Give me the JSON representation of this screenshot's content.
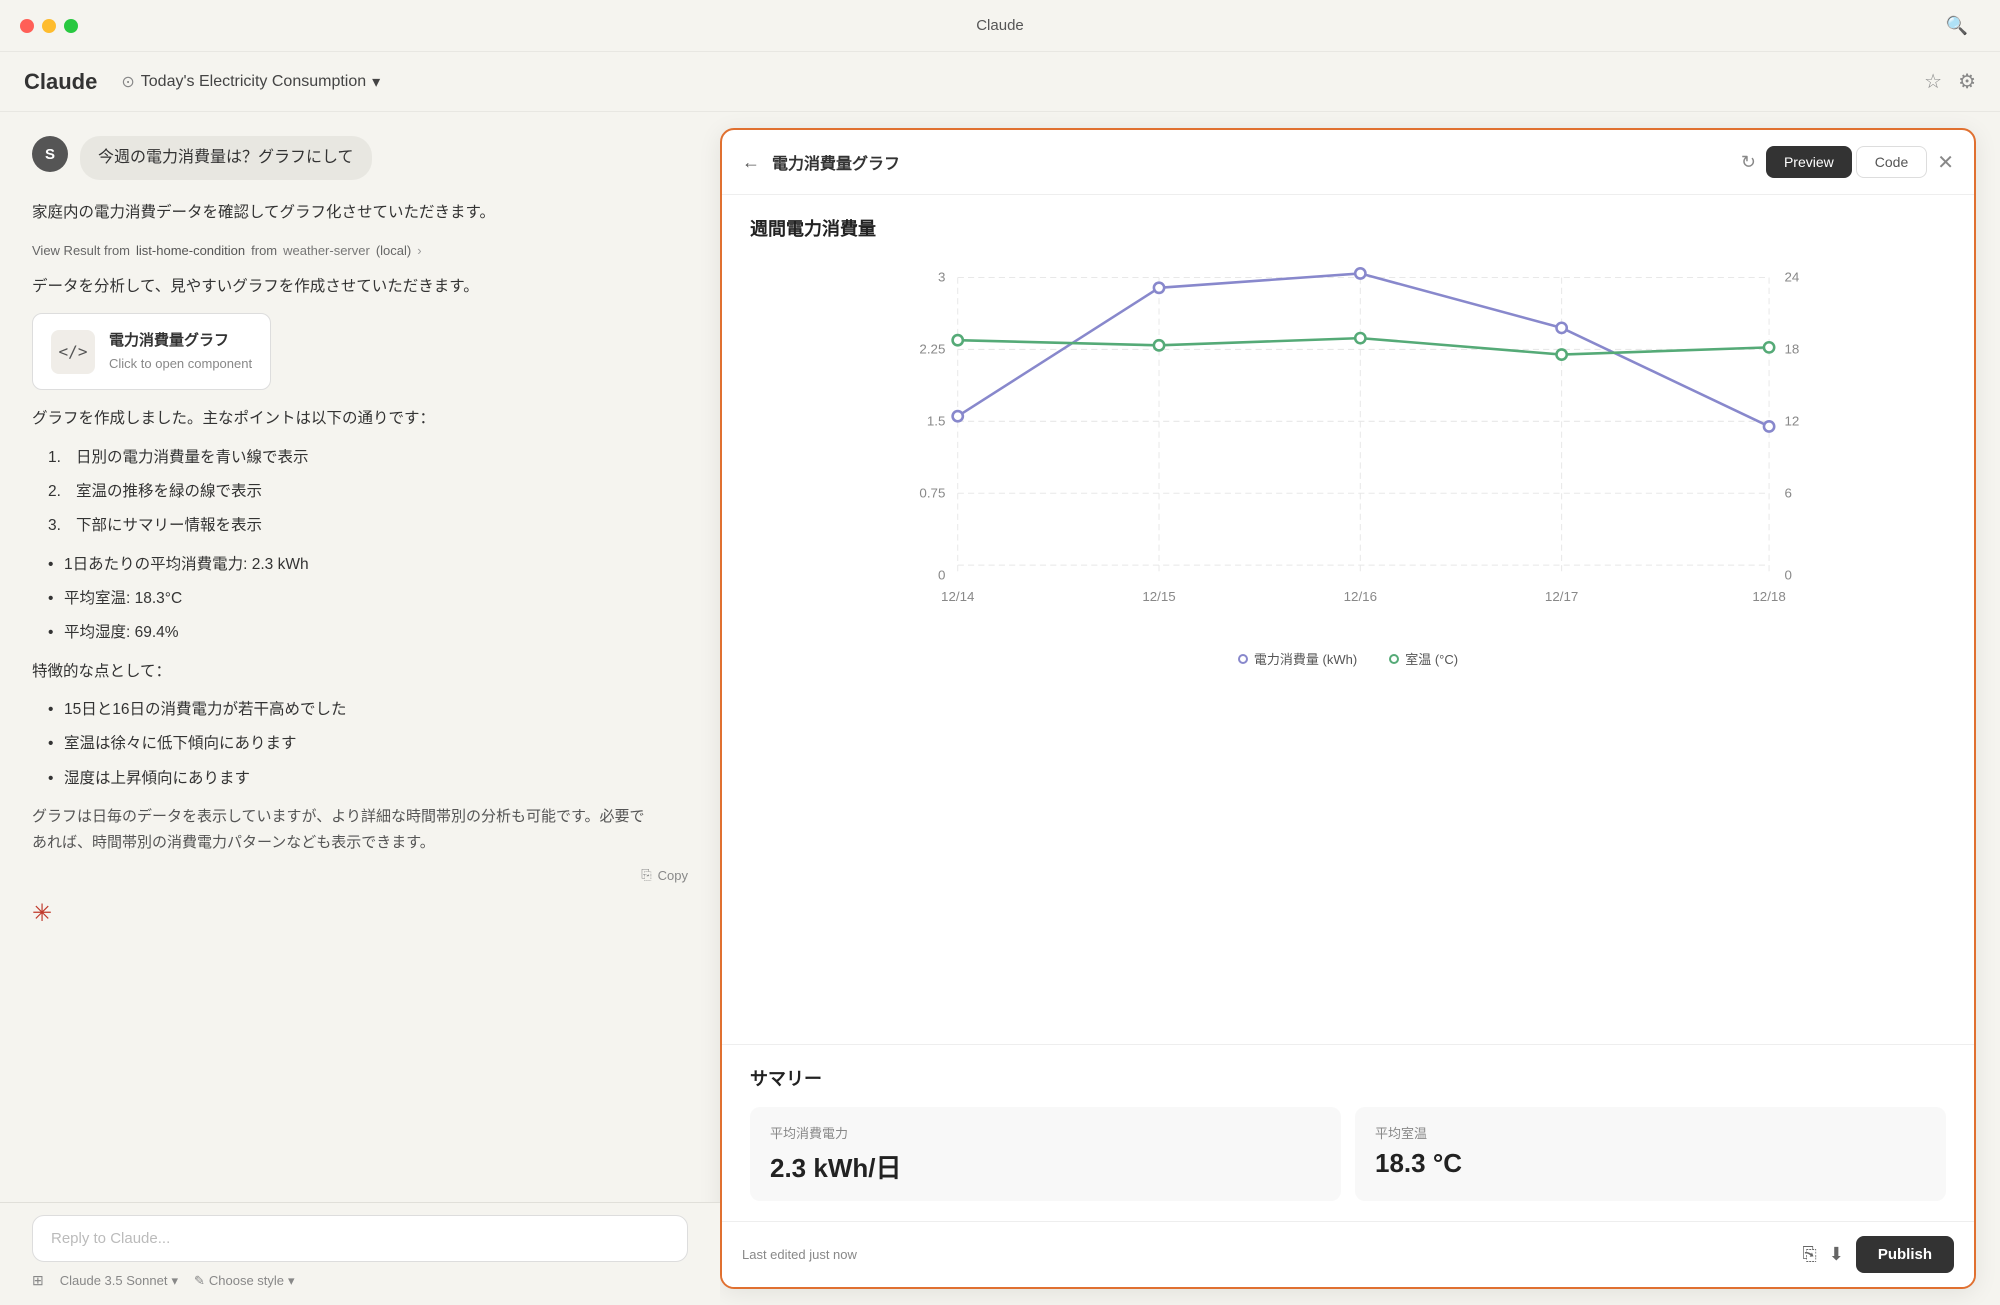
{
  "app": {
    "title": "Claude",
    "nav_title": "Today's Electricity Consumption",
    "nav_title_chevron": "▾",
    "logo": "Claude"
  },
  "traffic_lights": {
    "colors": [
      "red",
      "yellow",
      "green"
    ]
  },
  "chat": {
    "user_avatar_initial": "S",
    "user_message": "今週の電力消費量は？グラフにして",
    "assistant_intro": "家庭内の電力消費データを確認してグラフ化させていただきます。",
    "tool_call_prefix": "View Result from",
    "tool_call_fn": "list-home-condition",
    "tool_call_from": "from",
    "tool_call_server": "weather-server",
    "tool_call_local": "(local)",
    "tool_call_chevron": "›",
    "assistant_analysis": "データを分析して、見やすいグラフを作成させていただきます。",
    "component_label": "電力消費量グラフ",
    "component_subtitle": "Click to open component",
    "component_icon": "</>",
    "summary_intro": "グラフを作成しました。主なポイントは以下の通りです：",
    "numbered_points": [
      "日別の電力消費量を青い線で表示",
      "室温の推移を緑の線で表示",
      "下部にサマリー情報を表示"
    ],
    "bullet_points": [
      "1日あたりの平均消費電力: 2.3 kWh",
      "平均室温: 18.3°C",
      "平均湿度: 69.4%"
    ],
    "features_intro": "特徴的な点として：",
    "features": [
      "15日と16日の消費電力が若干高めでした",
      "室温は徐々に低下傾向にあります",
      "湿度は上昇傾向にあります"
    ],
    "tail_text": "グラフは日毎のデータを表示していますが、より詳細な時間帯別の分析も可能です。必要で\nあれば、時間帯別の消費電力パターンなども表示できます。",
    "copy_button": "Copy"
  },
  "input": {
    "placeholder": "Reply to Claude...",
    "model": "Claude 3.5 Sonnet",
    "model_chevron": "▾",
    "style_icon": "✎",
    "style_label": "Choose style",
    "style_chevron": "▾",
    "expand_icon": "⊞"
  },
  "preview": {
    "back_arrow": "←",
    "title": "電力消費量グラフ",
    "refresh_icon": "↻",
    "tab_preview": "Preview",
    "tab_code": "Code",
    "close_icon": "✕",
    "chart_title": "週間電力消費量",
    "legend_electricity": "電力消費量 (kWh)",
    "legend_temperature": "室温 (°C)",
    "x_labels": [
      "12/14",
      "12/15",
      "12/16",
      "12/17",
      "12/18"
    ],
    "y_left_labels": [
      "0",
      "0.75",
      "1.5",
      "2.25",
      "3"
    ],
    "y_right_labels": [
      "0",
      "6",
      "12",
      "18",
      "24"
    ],
    "electricity_data": [
      1.6,
      2.9,
      3.05,
      2.5,
      1.5
    ],
    "temperature_data": [
      2.3,
      2.25,
      2.35,
      2.15,
      2.25
    ],
    "summary_title": "サマリー",
    "card1_label": "平均消費電力",
    "card1_value": "2.3 kWh/日",
    "card2_label": "平均室温",
    "card2_value": "18.3 °C",
    "footer_status": "Last edited just now",
    "publish_button": "Publish"
  }
}
